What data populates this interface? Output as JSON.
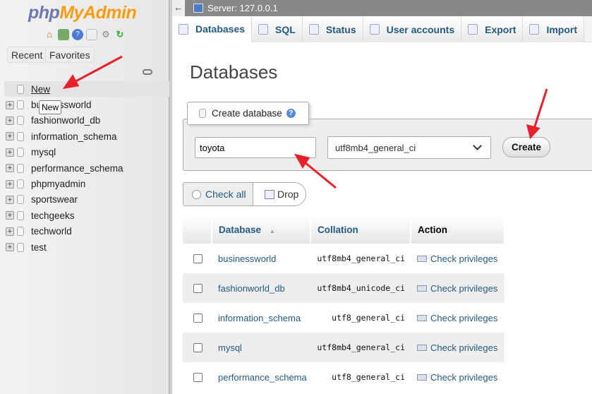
{
  "sidebar": {
    "logo": {
      "php": "php",
      "myadmin": "MyAdmin"
    },
    "icons": [
      "home-icon",
      "logout-icon",
      "help-icon",
      "docs-icon",
      "settings-icon",
      "reload-icon"
    ],
    "recent": "Recent",
    "favorites": "Favorites",
    "new": "New",
    "tooltip": "New",
    "databases": [
      "businessworld",
      "fashionworld_db",
      "information_schema",
      "mysql",
      "performance_schema",
      "phpmyadmin",
      "sportswear",
      "techgeeks",
      "techworld",
      "test"
    ]
  },
  "topbar": {
    "back": "←",
    "server": "Server: 127.0.0.1"
  },
  "tabs": [
    {
      "label": "Databases",
      "active": true
    },
    {
      "label": "SQL"
    },
    {
      "label": "Status"
    },
    {
      "label": "User accounts"
    },
    {
      "label": "Export"
    },
    {
      "label": "Import"
    }
  ],
  "main": {
    "title": "Databases",
    "create": {
      "legend": "Create database",
      "help": "?",
      "name_value": "toyota",
      "collation": "utf8mb4_general_ci",
      "button": "Create"
    },
    "check_all": "Check all",
    "drop": "Drop",
    "table": {
      "headers": [
        "Database",
        "Collation",
        "Action"
      ],
      "sort_indicator": "▲",
      "rows": [
        {
          "db": "businessworld",
          "collation": "utf8mb4_general_ci",
          "action": "Check privileges"
        },
        {
          "db": "fashionworld_db",
          "collation": "utf8mb4_unicode_ci",
          "action": "Check privileges"
        },
        {
          "db": "information_schema",
          "collation": "utf8_general_ci",
          "action": "Check privileges"
        },
        {
          "db": "mysql",
          "collation": "utf8mb4_general_ci",
          "action": "Check privileges"
        },
        {
          "db": "performance_schema",
          "collation": "utf8_general_ci",
          "action": "Check privileges"
        }
      ]
    }
  },
  "colors": {
    "accent": "#235a81",
    "annotation_arrow": "#e8202a"
  }
}
